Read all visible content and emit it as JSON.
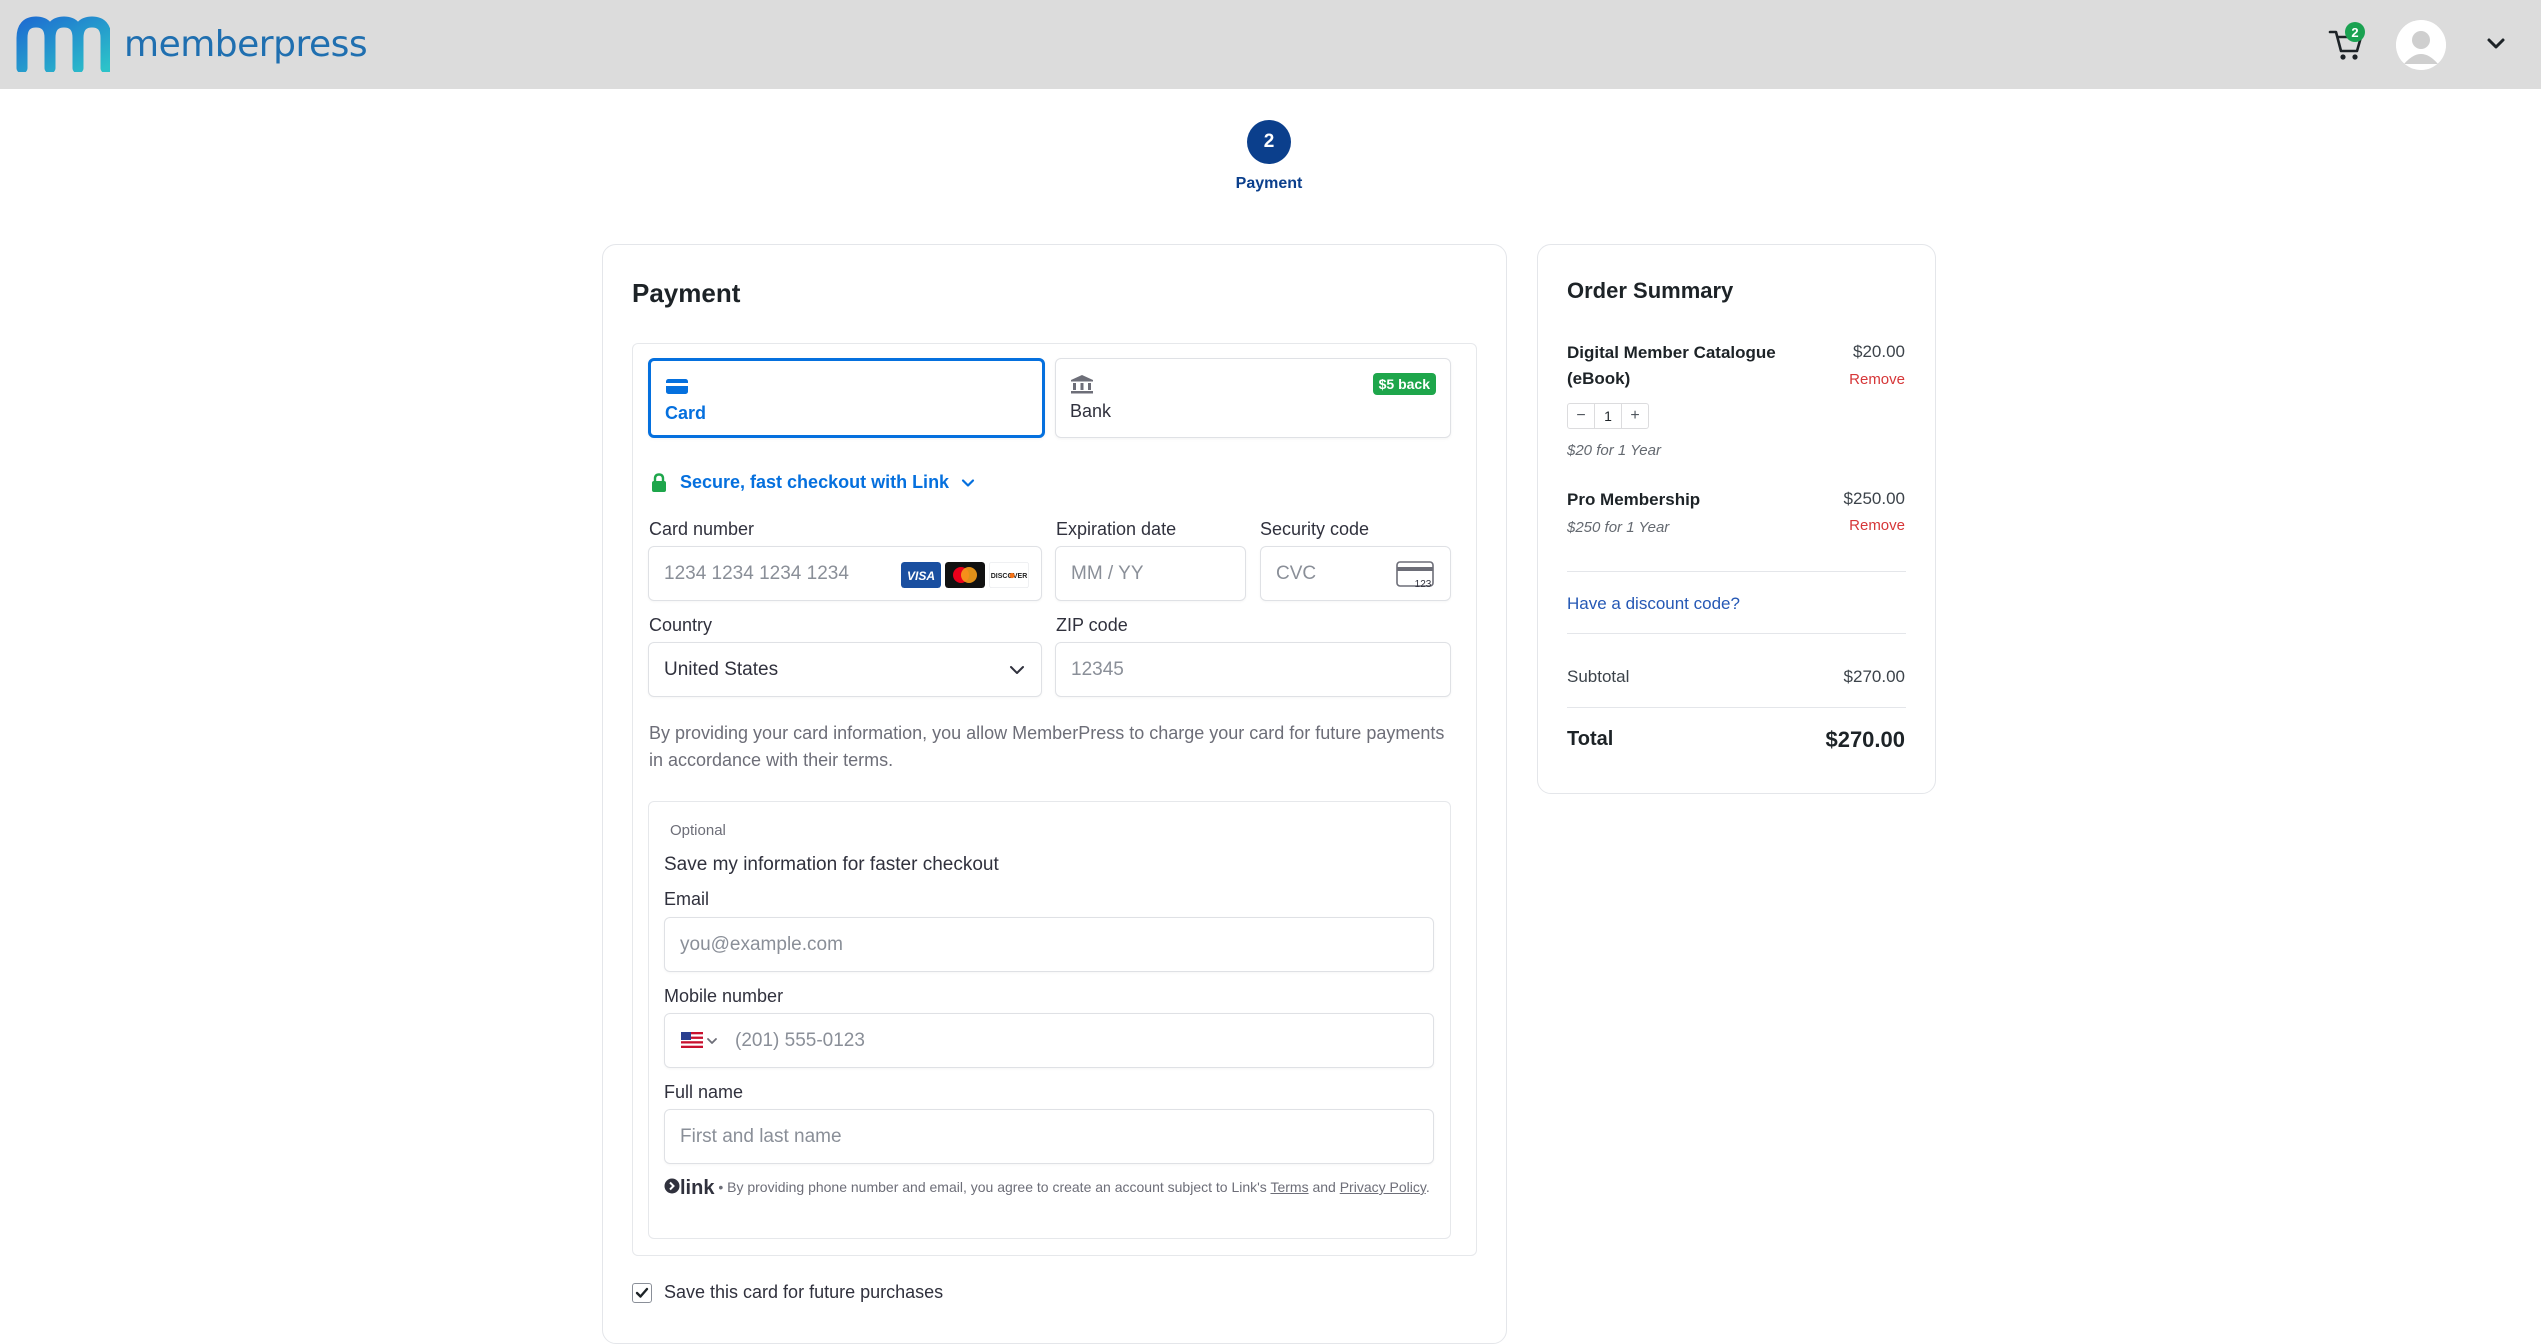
{
  "header": {
    "brand": "memberpress",
    "cart_count": "2",
    "icons": {
      "cart": "cart-icon",
      "avatar": "user-avatar-icon",
      "menu": "chevron-down-icon"
    }
  },
  "steps": {
    "current_number": "2",
    "current_label": "Payment"
  },
  "payment": {
    "title": "Payment",
    "methods": [
      {
        "label": "Card",
        "icon": "credit-card-icon",
        "selected": true
      },
      {
        "label": "Bank",
        "icon": "bank-icon",
        "badge": "$5 back",
        "selected": false
      }
    ],
    "link_checkout": "Secure, fast checkout with Link",
    "fields": {
      "card_number": {
        "label": "Card number",
        "placeholder": "1234 1234 1234 1234"
      },
      "expiration": {
        "label": "Expiration date",
        "placeholder": "MM / YY"
      },
      "security": {
        "label": "Security code",
        "placeholder": "CVC"
      },
      "country": {
        "label": "Country",
        "value": "United States"
      },
      "zip": {
        "label": "ZIP code",
        "placeholder": "12345"
      }
    },
    "card_brands": [
      "VISA",
      "Mastercard",
      "DISCOVER"
    ],
    "consent": "By providing your card information, you allow MemberPress to charge your card for future payments in accordance with their terms.",
    "link_save": {
      "optional": "Optional",
      "heading": "Save my information for faster checkout",
      "email_label": "Email",
      "email_placeholder": "you@example.com",
      "mobile_label": "Mobile number",
      "mobile_placeholder": "(201) 555-0123",
      "name_label": "Full name",
      "name_placeholder": "First and last name",
      "footer_logo": "link",
      "footer_text": " • By providing phone number and email, you agree to create an account subject to Link's ",
      "terms": "Terms",
      "and": " and ",
      "privacy": "Privacy Policy",
      "period": "."
    },
    "save_card_label": "Save this card for future purchases",
    "save_card_checked": true
  },
  "summary": {
    "title": "Order Summary",
    "items": [
      {
        "name": "Digital Member Catalogue (eBook)",
        "price": "$20.00",
        "remove": "Remove",
        "qty": "1",
        "minus": "−",
        "plus": "+",
        "term": "$20 for 1 Year"
      },
      {
        "name": "Pro Membership",
        "price": "$250.00",
        "remove": "Remove",
        "term": "$250 for 1 Year"
      }
    ],
    "discount_link": "Have a discount code?",
    "subtotal_label": "Subtotal",
    "subtotal_value": "$270.00",
    "total_label": "Total",
    "total_value": "$270.00"
  },
  "colors": {
    "accent": "#0570de",
    "brand_blue": "#0b3f8c",
    "link_green": "#1ea64b",
    "remove_red": "#d63638"
  }
}
